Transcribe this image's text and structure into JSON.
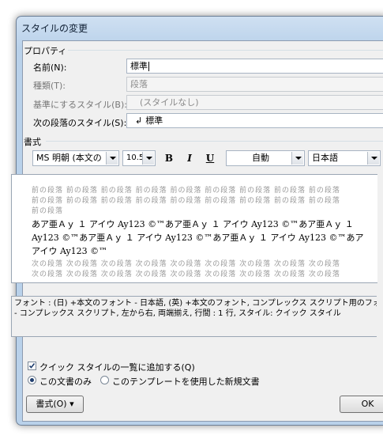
{
  "window": {
    "title": "スタイルの変更"
  },
  "properties": {
    "group_label": "プロパティ",
    "name_label": "名前(N):",
    "name_value": "標準",
    "type_label": "種類(T):",
    "type_value": "段落",
    "based_on_label": "基準にするスタイル(B):",
    "based_on_value": "(スタイルなし)",
    "next_style_label": "次の段落のスタイル(S):",
    "next_style_value": "標準"
  },
  "formatting": {
    "group_label": "書式",
    "font_value": "MS 明朝 (本文の",
    "size_value": "10.5",
    "bold_label": "B",
    "italic_label": "I",
    "underline_label": "U",
    "color_value": "自動",
    "language_value": "日本語"
  },
  "preview": {
    "prev_line": "前の段落 前の段落 前の段落 前の段落 前の段落 前の段落 前の段落 前の段落 前の段落",
    "prev_short": "前の段落",
    "sample_line_1": "あア亜Ａｙ １ アイウ Ay123 ©™あア亜Ａｙ １ アイウ Ay123 ©™あア亜Ａｙ １",
    "sample_line_2": "Ay123 ©™あア亜Ａｙ １ アイウ Ay123 ©™あア亜Ａｙ １ アイウ Ay123 ©™あア",
    "sample_line_3": "アイウ Ay123 ©™",
    "next_line": "次の段落 次の段落 次の段落 次の段落 次の段落 次の段落 次の段落 次の段落 次の段落"
  },
  "description": {
    "line_1": "フォント : (日) +本文のフォント - 日本語, (英) +本文のフォント, コンプレックス スクリプト用のフォン",
    "line_2": "- コンプレックス スクリプト, 左から右, 両端揃え, 行間 :  1 行, スタイル: クイック スタイル"
  },
  "options": {
    "quick_style_label": "クイック スタイルの一覧に追加する(Q)",
    "this_document_label": "この文書のみ",
    "new_documents_label": "このテンプレートを使用した新規文書"
  },
  "buttons": {
    "format_label": "書式(O) ▾",
    "ok_label": "OK"
  }
}
